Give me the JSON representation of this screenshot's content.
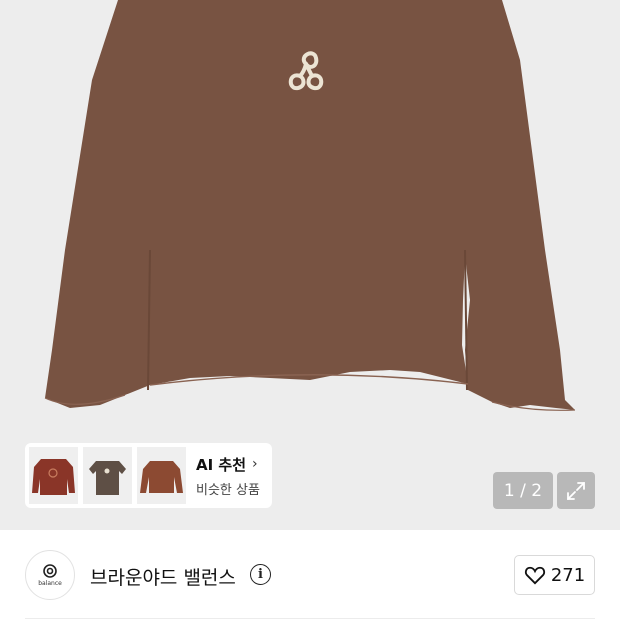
{
  "gallery": {
    "image_icon": "trinity-spiral-icon",
    "pager_text": "1 / 2",
    "expand_icon": "expand-icon"
  },
  "ai_recommend": {
    "title": "AI 추천",
    "chevron": "›",
    "subtitle": "비슷한 상품",
    "thumbnails": [
      "sweatshirt-thumb",
      "tee-thumb",
      "longsleeve-thumb"
    ]
  },
  "brand": {
    "name": "브라운야드 밸런스",
    "logo_text": "balance",
    "info_glyph": "i",
    "like_count": "271"
  },
  "colors": {
    "garment": "#785342",
    "hero_bg": "#ededed",
    "print": "#ece4d4"
  }
}
